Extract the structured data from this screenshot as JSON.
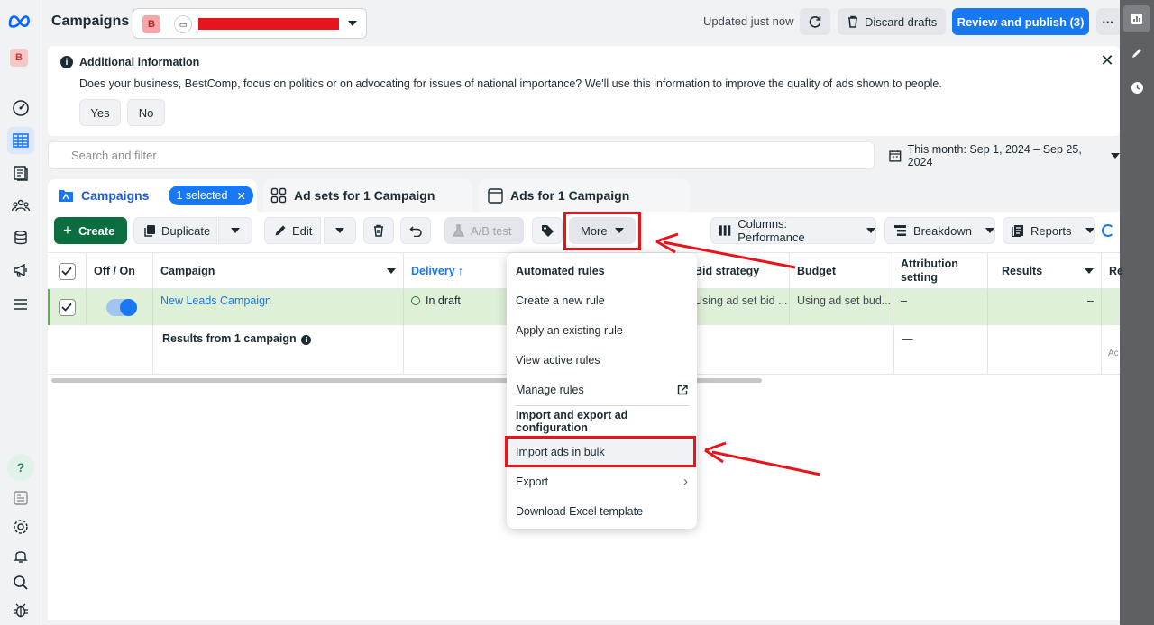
{
  "header": {
    "title": "Campaigns",
    "account_badge": "B",
    "updated": "Updated just now",
    "discard_label": "Discard drafts",
    "review_label": "Review and publish (3)",
    "more_label": "···"
  },
  "leftnav": {
    "account_badge": "B"
  },
  "banner": {
    "title": "Additional information",
    "text": "Does your business, BestComp, focus on politics or on advocating for issues of national importance? We'll use this information to improve the quality of ads shown to people.",
    "yes": "Yes",
    "no": "No"
  },
  "search": {
    "placeholder": "Search and filter",
    "daterange": "This month: Sep 1, 2024 – Sep 25, 2024"
  },
  "tabs": {
    "campaigns": "Campaigns",
    "selected": "1 selected",
    "adsets": "Ad sets for 1 Campaign",
    "ads": "Ads for 1 Campaign"
  },
  "toolbar": {
    "create": "Create",
    "duplicate": "Duplicate",
    "edit": "Edit",
    "ab_test": "A/B test",
    "more": "More",
    "columns": "Columns: Performance",
    "breakdown": "Breakdown",
    "reports": "Reports"
  },
  "table": {
    "headers": {
      "offon": "Off / On",
      "campaign": "Campaign",
      "delivery": "Delivery",
      "bid": "Bid strategy",
      "budget": "Budget",
      "attribution": "Attribution setting",
      "results": "Results",
      "re": "Re"
    },
    "row": {
      "campaign": "New Leads Campaign",
      "delivery": "In draft",
      "bid": "Using ad set bid ...",
      "budget": "Using ad set bud...",
      "attribution": "–",
      "results": "–"
    },
    "summary": {
      "label": "Results from 1 campaign",
      "attribution": "—",
      "re": "Ac"
    }
  },
  "menu": {
    "automated_header": "Automated rules",
    "items1": [
      "Create a new rule",
      "Apply an existing rule",
      "View active rules",
      "Manage rules"
    ],
    "import_header": "Import and export ad configuration",
    "items2": [
      "Import ads in bulk",
      "Export",
      "Download Excel template"
    ]
  },
  "colors": {
    "accent": "#1877f2",
    "create_green": "#0a6e3e",
    "highlight_red": "#e8141c",
    "row_selected": "#dff0d8"
  }
}
